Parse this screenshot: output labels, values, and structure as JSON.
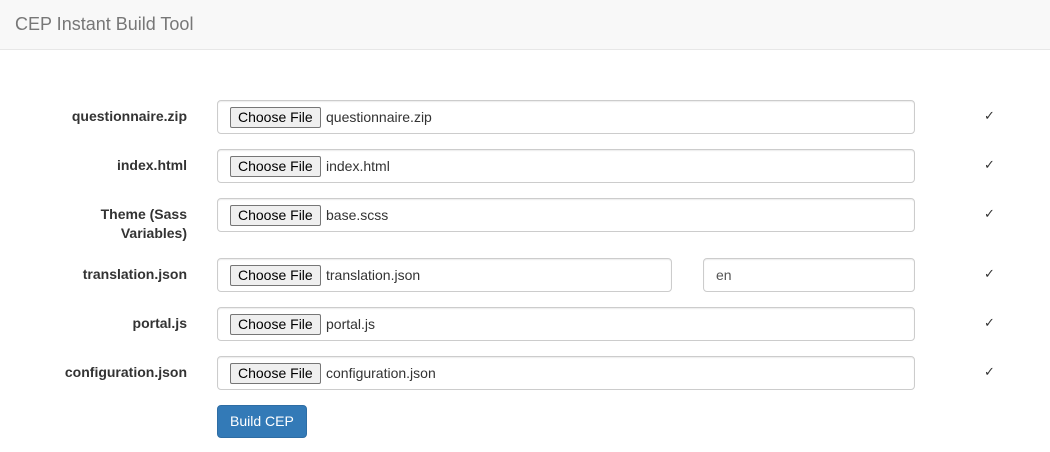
{
  "header": {
    "title": "CEP Instant Build Tool"
  },
  "form": {
    "rows": [
      {
        "label": "questionnaire.zip",
        "button_label": "Choose File",
        "file_name": "questionnaire.zip",
        "status": "✓"
      },
      {
        "label": "index.html",
        "button_label": "Choose File",
        "file_name": "index.html",
        "status": "✓"
      },
      {
        "label": "Theme (Sass Variables)",
        "label_line1": "Theme (Sass",
        "label_line2": "Variables)",
        "button_label": "Choose File",
        "file_name": "base.scss",
        "status": "✓"
      },
      {
        "label": "translation.json",
        "button_label": "Choose File",
        "file_name": "translation.json",
        "language_value": "en",
        "status": "✓"
      },
      {
        "label": "portal.js",
        "button_label": "Choose File",
        "file_name": "portal.js",
        "status": "✓"
      },
      {
        "label": "configuration.json",
        "button_label": "Choose File",
        "file_name": "configuration.json",
        "status": "✓"
      }
    ],
    "submit_label": "Build CEP"
  }
}
